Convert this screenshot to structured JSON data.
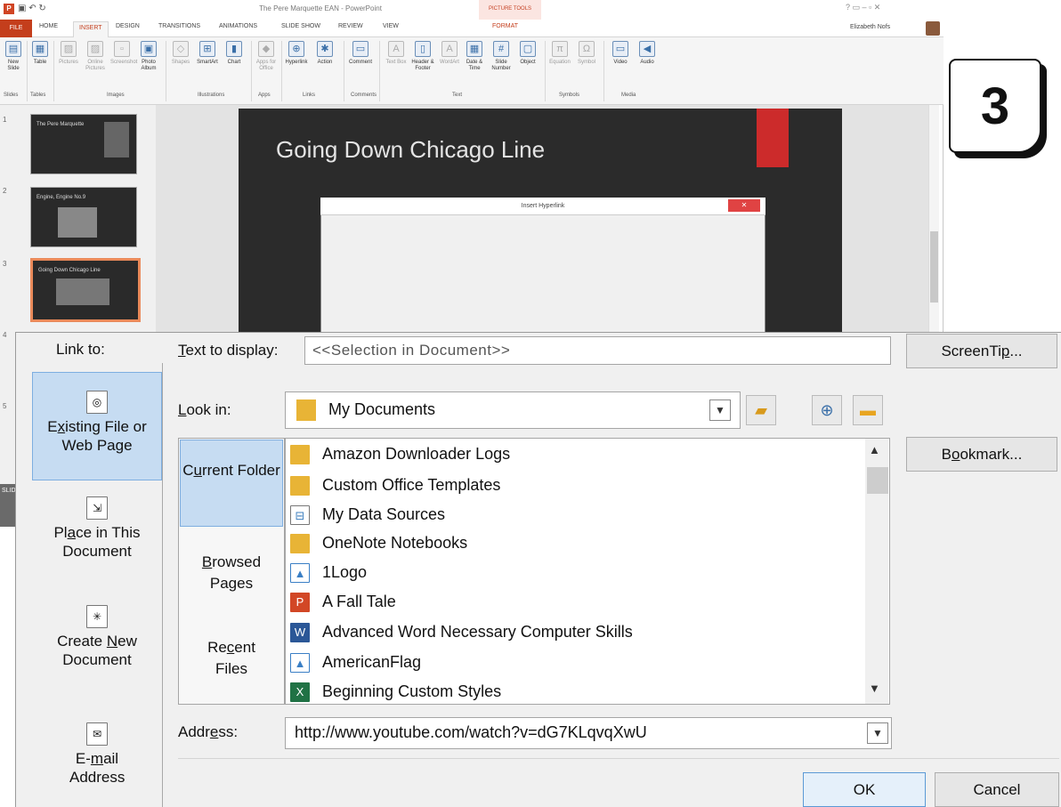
{
  "app": {
    "title": "The Pere Marquette EAN - PowerPoint",
    "picture_tools": "PICTURE TOOLS",
    "user": "Elizabeth Nofs",
    "tabs": [
      "FILE",
      "HOME",
      "INSERT",
      "DESIGN",
      "TRANSITIONS",
      "ANIMATIONS",
      "SLIDE SHOW",
      "REVIEW",
      "VIEW",
      "FORMAT"
    ],
    "ribbon_groups": [
      "Slides",
      "Tables",
      "Images",
      "Illustrations",
      "Apps",
      "Links",
      "Comments",
      "Text",
      "Symbols",
      "Media"
    ],
    "ribbon_buttons": {
      "new_slide": "New Slide",
      "table": "Table",
      "pictures": "Pictures",
      "online_pictures": "Online Pictures",
      "screenshot": "Screenshot",
      "photo_album": "Photo Album",
      "shapes": "Shapes",
      "smartart": "SmartArt",
      "chart": "Chart",
      "apps_for_office": "Apps for Office",
      "hyperlink": "Hyperlink",
      "action": "Action",
      "comment": "Comment",
      "text_box": "Text Box",
      "header_footer": "Header & Footer",
      "wordart": "WordArt",
      "date_time": "Date & Time",
      "slide_number": "Slide Number",
      "object": "Object",
      "equation": "Equation",
      "symbol": "Symbol",
      "video": "Video",
      "audio": "Audio"
    },
    "slide_numbers": [
      "1",
      "2",
      "3",
      "4",
      "5"
    ],
    "thumbs": [
      "The Pere Marquette",
      "Engine, Engine No.9",
      "Going Down Chicago Line"
    ],
    "slide_title": "Going Down Chicago Line",
    "mini_dialog_title": "Insert Hyperlink",
    "status_text": "SLID"
  },
  "step_badge": "3",
  "dialog": {
    "link_to_label": "Link to:",
    "link_to_items": [
      {
        "pre": "E",
        "u": "x",
        "post": "isting File or Web Page",
        "icon": "existing-file-icon"
      },
      {
        "pre": "Pl",
        "u": "a",
        "post": "ce in This Document",
        "icon": "place-in-document-icon"
      },
      {
        "pre": "Create ",
        "u": "N",
        "post": "ew Document",
        "icon": "new-document-icon"
      },
      {
        "pre": "E-",
        "u": "m",
        "post": "ail Address",
        "icon": "email-icon"
      }
    ],
    "text_to_display_label_pre": "",
    "text_to_display_label_u": "T",
    "text_to_display_label_post": "ext to display:",
    "text_to_display_value": "<<Selection in Document>>",
    "screentip_pre": "ScreenTi",
    "screentip_u": "p",
    "screentip_post": "...",
    "look_in_label_pre": "",
    "look_in_label_u": "L",
    "look_in_label_post": "ook in:",
    "look_in_value": "My Documents",
    "bookmark_pre": "B",
    "bookmark_u": "o",
    "bookmark_post": "okmark...",
    "folder_tabs": [
      {
        "pre": "C",
        "u": "u",
        "post": "rrent Folder"
      },
      {
        "pre": "",
        "u": "B",
        "post": "rowsed Pages"
      },
      {
        "pre": "Re",
        "u": "c",
        "post": "ent Files"
      }
    ],
    "files": [
      {
        "name": "Amazon Downloader Logs",
        "type": "folder"
      },
      {
        "name": "Custom Office Templates",
        "type": "folder"
      },
      {
        "name": "My Data Sources",
        "type": "datasrc"
      },
      {
        "name": "OneNote Notebooks",
        "type": "folder"
      },
      {
        "name": "1Logo",
        "type": "image"
      },
      {
        "name": "A Fall Tale",
        "type": "ppt"
      },
      {
        "name": "Advanced Word Necessary Computer Skills",
        "type": "word"
      },
      {
        "name": "AmericanFlag",
        "type": "image"
      },
      {
        "name": "Beginning Custom Styles",
        "type": "excel"
      }
    ],
    "address_label_pre": "Addr",
    "address_label_u": "e",
    "address_label_post": "ss:",
    "address_value": "http://www.youtube.com/watch?v=dG7KLqvqXwU",
    "ok": "OK",
    "cancel": "Cancel"
  },
  "colors": {
    "accent_selected": "#c6dcf2",
    "ppt_orange": "#c43e1c",
    "slide_red": "#cc2b2b"
  }
}
